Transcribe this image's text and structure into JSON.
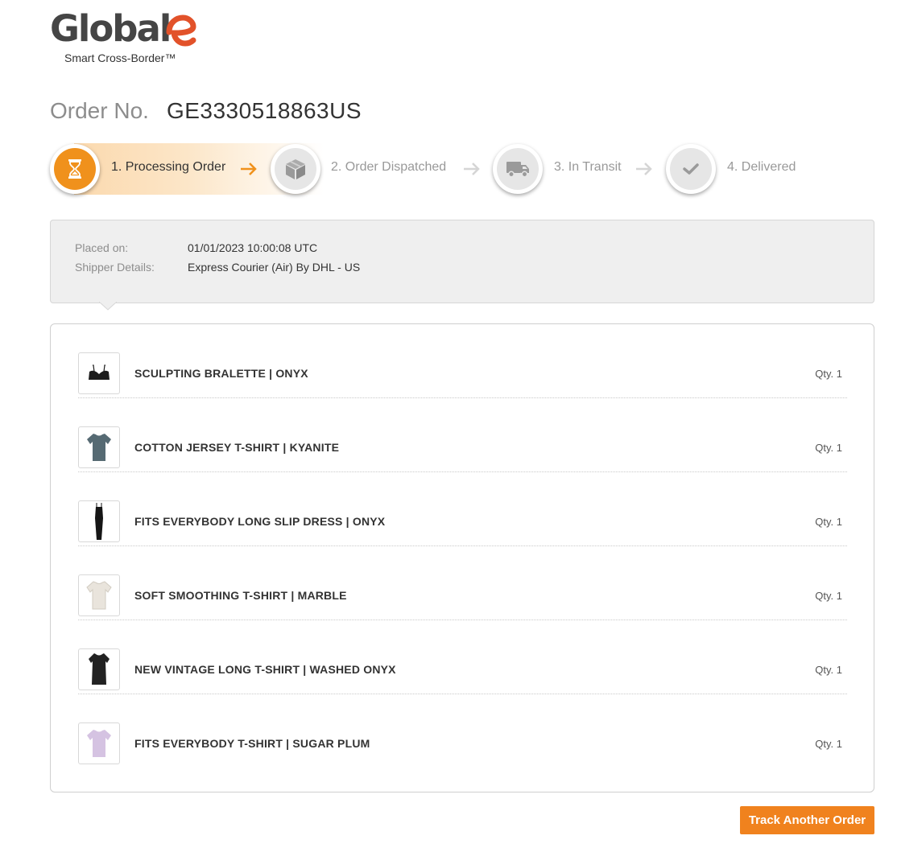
{
  "brand": {
    "logo_text": "Global",
    "logo_e": "e",
    "tagline": "Smart Cross-Border™",
    "accent_color": "#f0911c",
    "logo_accent_color": "#e2522a"
  },
  "order": {
    "label": "Order No.",
    "number": "GE3330518863US"
  },
  "steps": [
    {
      "label": "1. Processing Order",
      "icon": "hourglass-icon",
      "active": true
    },
    {
      "label": "2. Order Dispatched",
      "icon": "box-icon",
      "active": false
    },
    {
      "label": "3. In Transit",
      "icon": "truck-icon",
      "active": false
    },
    {
      "label": "4. Delivered",
      "icon": "check-icon",
      "active": false
    }
  ],
  "details": {
    "placed_on_label": "Placed on:",
    "placed_on_value": "01/01/2023 10:00:08 UTC",
    "shipper_label": "Shipper Details:",
    "shipper_value": "Express Courier (Air) By DHL - US"
  },
  "items": [
    {
      "name": "SCULPTING BRALETTE | ONYX",
      "qty": "Qty. 1",
      "thumb": "bralette",
      "color": "#1c1c1c"
    },
    {
      "name": "COTTON JERSEY T-SHIRT | KYANITE",
      "qty": "Qty. 1",
      "thumb": "tshirt",
      "color": "#566a73"
    },
    {
      "name": "FITS EVERYBODY LONG SLIP DRESS | ONYX",
      "qty": "Qty. 1",
      "thumb": "dress",
      "color": "#161616"
    },
    {
      "name": "SOFT SMOOTHING T-SHIRT | MARBLE",
      "qty": "Qty. 1",
      "thumb": "tshirt",
      "color": "#e9e4dc"
    },
    {
      "name": "NEW VINTAGE LONG T-SHIRT | WASHED ONYX",
      "qty": "Qty. 1",
      "thumb": "longtee",
      "color": "#222222"
    },
    {
      "name": "FITS EVERYBODY T-SHIRT | SUGAR PLUM",
      "qty": "Qty. 1",
      "thumb": "tshirt",
      "color": "#d5c3e2"
    }
  ],
  "actions": {
    "track_another_label": "Track Another Order",
    "button_color": "#f0821e"
  }
}
